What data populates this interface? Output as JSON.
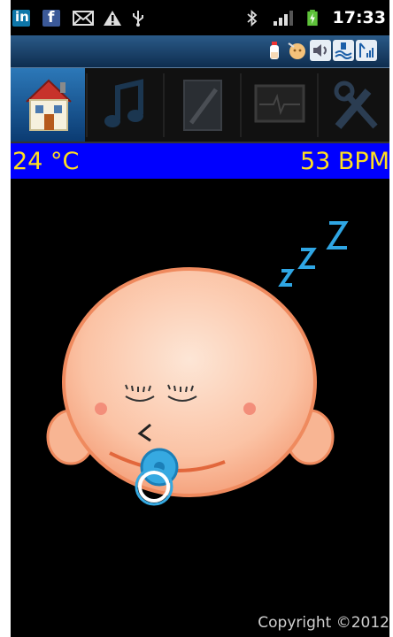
{
  "status_bar": {
    "time": "17:33",
    "icons": [
      "linkedin-icon",
      "facebook-icon",
      "mail-icon",
      "warning-icon",
      "usb-icon",
      "bluetooth-icon",
      "signal-icon",
      "battery-charging-icon"
    ],
    "linkedin_text": "in",
    "facebook_text": "f"
  },
  "notifications": [
    "bottle-icon",
    "feeding-icon",
    "volume-icon",
    "monitor-icon",
    "network-icon"
  ],
  "tabs": [
    {
      "name": "home",
      "icon": "house-icon",
      "active": true
    },
    {
      "name": "music",
      "icon": "music-note-icon",
      "active": false
    },
    {
      "name": "notes",
      "icon": "notebook-icon",
      "active": false
    },
    {
      "name": "monitor",
      "icon": "heart-monitor-icon",
      "active": false
    },
    {
      "name": "settings",
      "icon": "tools-icon",
      "active": false
    }
  ],
  "info": {
    "temperature": "24 °C",
    "heart_rate": "53 BPM"
  },
  "footer": {
    "copyright": "Copyright ©2012"
  },
  "colors": {
    "info_bar": "#0000ff",
    "info_text": "#ffde21",
    "active_tab": "#2c78b8"
  }
}
